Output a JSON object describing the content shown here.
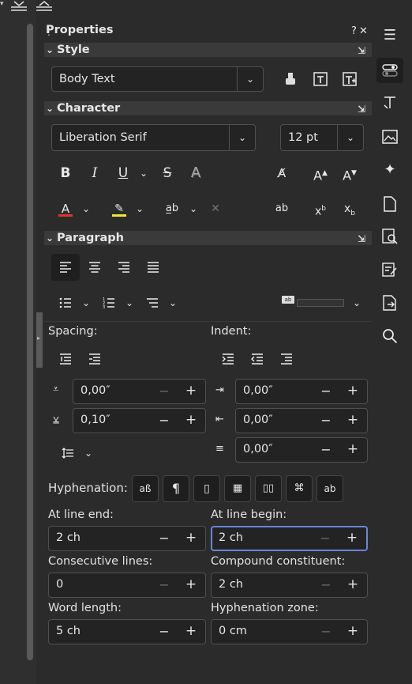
{
  "panel": {
    "title": "Properties",
    "help_label": "?",
    "close_label": "✕",
    "sections": {
      "style": "Style",
      "character": "Character",
      "paragraph": "Paragraph"
    }
  },
  "style": {
    "paragraph_style": "Body Text"
  },
  "character": {
    "font_name": "Liberation Serif",
    "font_size": "12 pt",
    "font_color": "#e03434",
    "highlight_color": "#f2e33a"
  },
  "paragraph": {
    "spacing_label": "Spacing:",
    "indent_label": "Indent:",
    "above_spacing": "0,00″",
    "below_spacing": "0,10″",
    "before_indent": "0,00″",
    "after_indent": "0,00″",
    "first_line_indent": "0,00″",
    "hyphenation_label": "Hyphenation:",
    "at_line_end_label": "At line end:",
    "at_line_end": "2 ch",
    "at_line_begin_label": "At line begin:",
    "at_line_begin": "2 ch",
    "consecutive_lines_label": "Consecutive lines:",
    "consecutive_lines": "0",
    "compound_constituent_label": "Compound constituent:",
    "compound_constituent": "2 ch",
    "word_length_label": "Word length:",
    "word_length": "5 ch",
    "hyphenation_zone_label": "Hyphenation zone:",
    "hyphenation_zone": "0 cm"
  },
  "icons": {
    "minus": "−",
    "plus": "+",
    "chevron": "⌄"
  }
}
